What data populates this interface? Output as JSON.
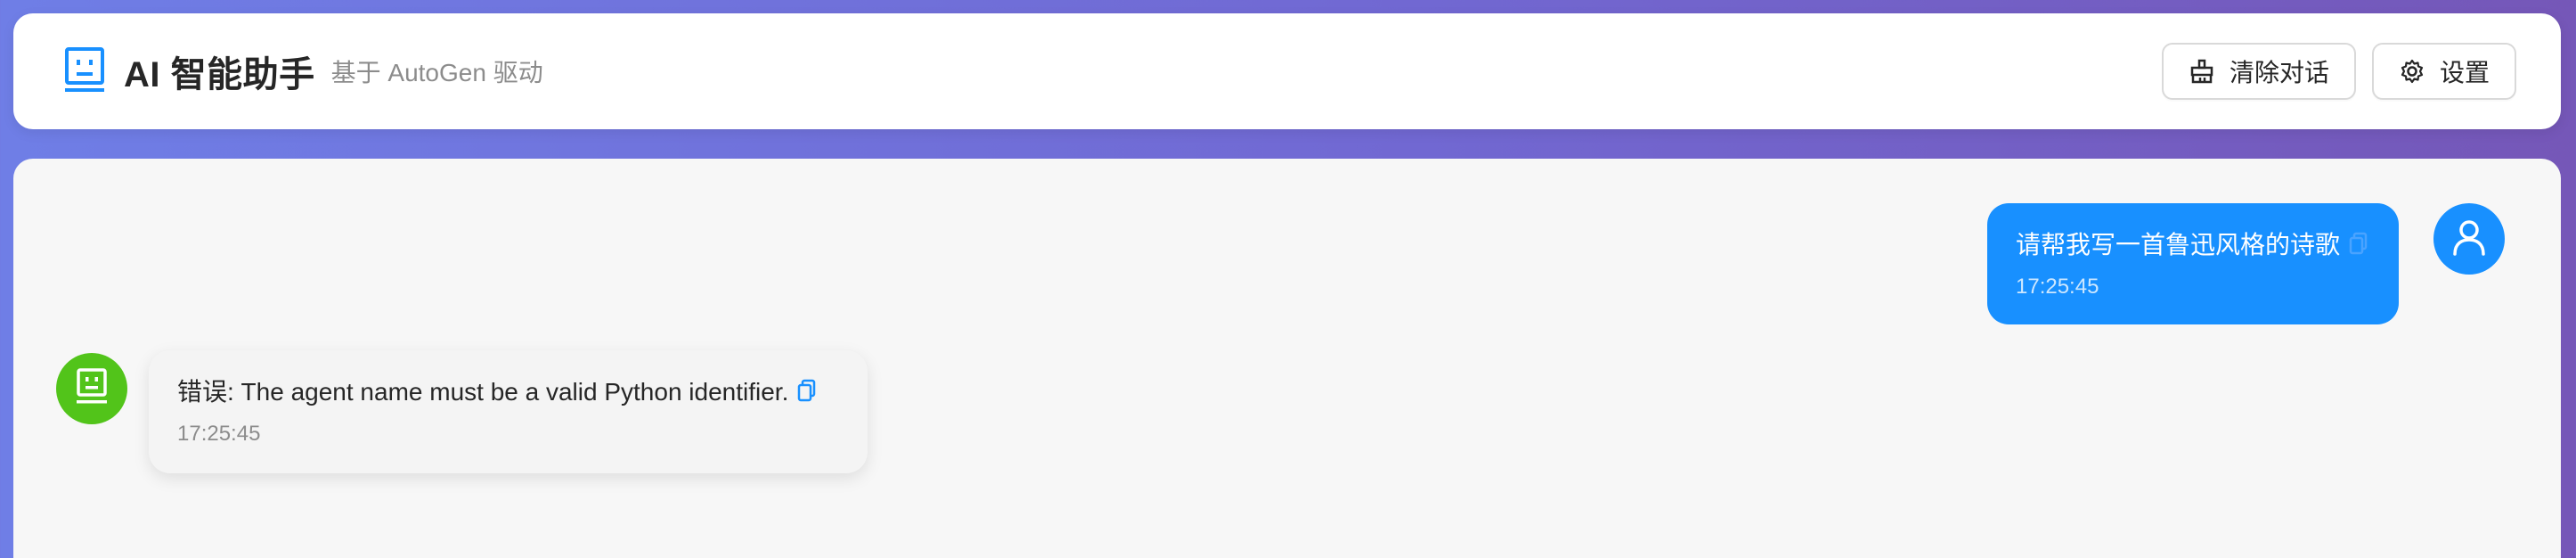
{
  "header": {
    "title": "AI 智能助手",
    "subtitle": "基于 AutoGen 驱动",
    "logo_icon": "robot-icon",
    "buttons": {
      "clear_label": "清除对话",
      "clear_icon": "broom-icon",
      "settings_label": "设置",
      "settings_icon": "gear-icon"
    }
  },
  "messages": [
    {
      "role": "user",
      "text": "请帮我写一首鲁迅风格的诗歌",
      "time": "17:25:45",
      "avatar_icon": "user-icon",
      "copy_icon": "copy-icon"
    },
    {
      "role": "bot",
      "text": "错误: The agent name must be a valid Python identifier.",
      "time": "17:25:45",
      "avatar_icon": "robot-icon",
      "copy_icon": "copy-icon"
    }
  ],
  "colors": {
    "background_gradient_start": "#6f7ee6",
    "background_gradient_end": "#7557b8",
    "accent_blue": "#1890ff",
    "bot_green": "#52c41a"
  }
}
